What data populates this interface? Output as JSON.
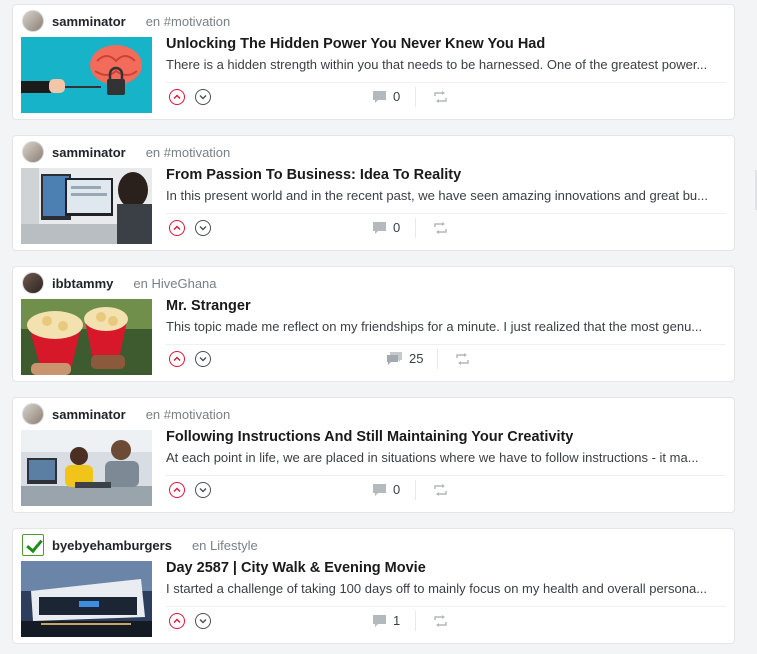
{
  "posts": [
    {
      "author": "samminator",
      "community": "en #motivation",
      "title": "Unlocking The Hidden Power You Never Knew You Had",
      "summary": "There is a hidden strength within you that needs to be harnessed. One of the greatest power...",
      "comments": "0",
      "avatar": "avatar",
      "thumbnail": "brain-padlock-image"
    },
    {
      "author": "samminator",
      "community": "en #motivation",
      "title": "From Passion To Business: Idea To Reality",
      "summary": "In this present world and in the recent past, we have seen amazing innovations and great bu...",
      "comments": "0",
      "avatar": "avatar",
      "thumbnail": "office-computers-image"
    },
    {
      "author": "ibbtammy",
      "community": "en HiveGhana",
      "title": "Mr. Stranger",
      "summary": "This topic made me reflect on my friendships for a minute. I just realized that the most genu...",
      "comments": "25",
      "avatar": "avatar",
      "thumbnail": "popcorn-cups-image"
    },
    {
      "author": "samminator",
      "community": "en #motivation",
      "title": "Following Instructions And Still Maintaining Your Creativity",
      "summary": "At each point in life, we are placed in situations where we have to follow instructions - it ma...",
      "comments": "0",
      "avatar": "avatar",
      "thumbnail": "coworkers-laptop-image"
    },
    {
      "author": "byebyehamburgers",
      "community": "en Lifestyle",
      "title": "Day 2587 | City Walk & Evening Movie",
      "summary": "I started a challenge of taking 100 days off to mainly focus on my health and overall persona...",
      "comments": "1",
      "avatar": "checkmark-avatar",
      "thumbnail": "building-night-image"
    }
  ],
  "icons": {
    "upvote": "chevron-up-icon",
    "downvote": "chevron-down-icon",
    "comments": "comment-icon",
    "reblog": "reblog-icon"
  },
  "colors": {
    "upvote": "#e31337",
    "muted": "#788187",
    "background": "#f3f4f5"
  }
}
